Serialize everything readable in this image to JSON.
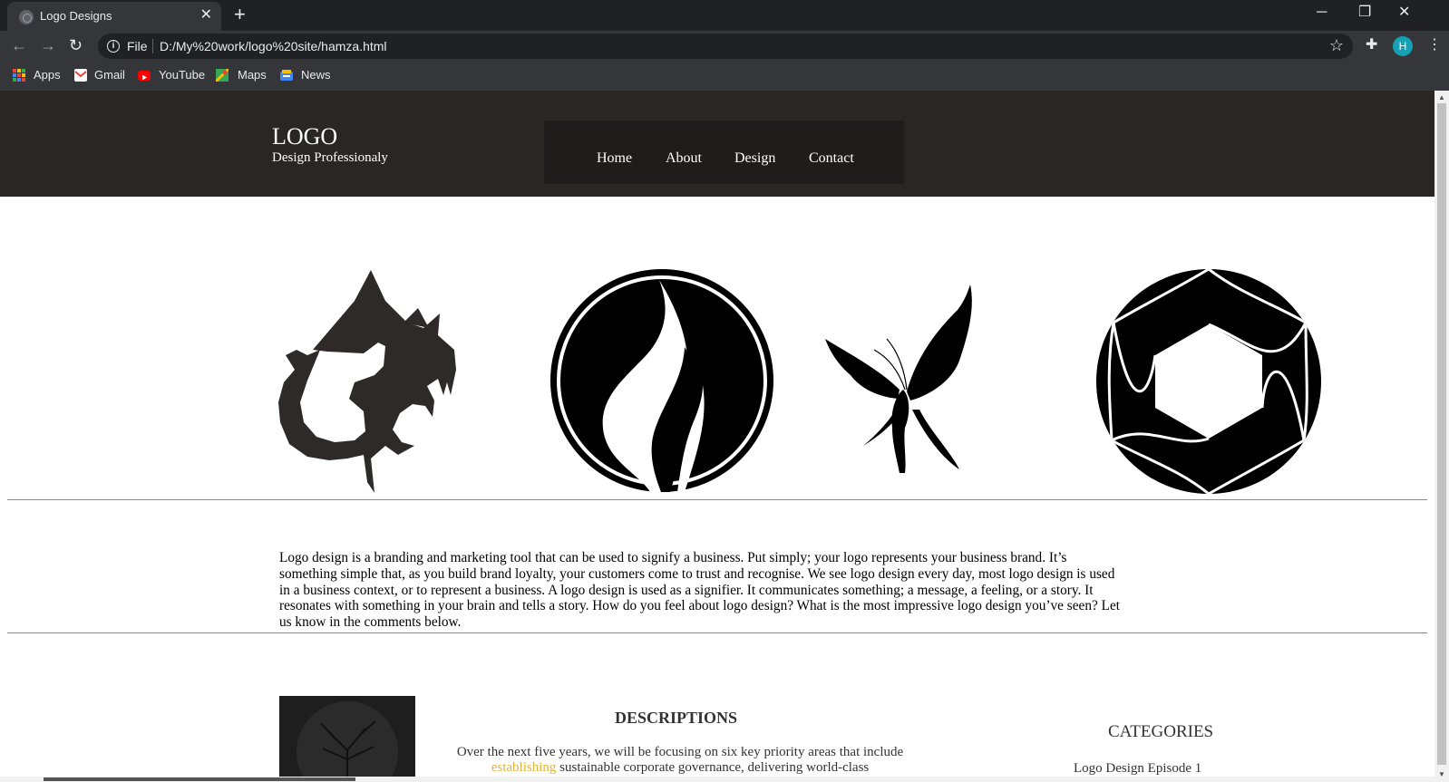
{
  "browser": {
    "tab_title": "Logo Designs",
    "url_scheme": "File",
    "url": "D:/My%20work/logo%20site/hamza.html",
    "profile_initial": "H",
    "bookmarks": [
      "Apps",
      "Gmail",
      "YouTube",
      "Maps",
      "News"
    ]
  },
  "site": {
    "logo": "LOGO",
    "tagline": "Design Professionaly",
    "nav": [
      "Home",
      "About",
      "Design",
      "Contact"
    ],
    "gallery": [
      "dragon-logo",
      "flame-logo",
      "butterfly-logo",
      "aperture-logo"
    ],
    "intro": "Logo design is a branding and marketing tool that can be used to signify a business. Put simply; your logo represents your business brand. It’s something simple that, as you build brand loyalty, your customers come to trust and recognise. We see logo design every day, most logo design is used in a business context, or to represent a business. A logo design is used as a signifier. It communicates something; a message, a feeling, or a story. It resonates with something in your brain and tells a story. How do you feel about logo design? What is the most impressive logo design you’ve seen? Let us know in the comments below.",
    "descriptions_title": "DESCRIPTIONS",
    "descriptions_text_1": "Over the next five years, we will be focusing on six key priority areas that include",
    "descriptions_link": "establishing",
    "descriptions_text_2": "sustainable corporate governance, delivering world-class",
    "categories_title": "CATEGORIES",
    "categories_first": "Logo Design Episode 1"
  },
  "colors": {
    "header_bg": "#2a2624",
    "nav_bg": "#201c1b",
    "link_accent": "#e2b33c"
  }
}
